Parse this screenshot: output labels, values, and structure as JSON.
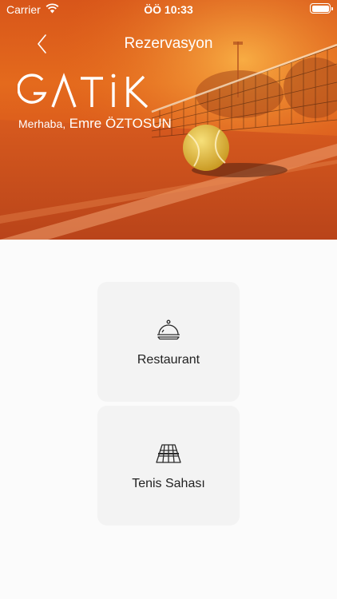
{
  "status_bar": {
    "carrier": "Carrier",
    "time": "ÖÖ 10:33",
    "icons": [
      "wifi-icon",
      "battery-icon"
    ]
  },
  "nav": {
    "title": "Rezervasyon",
    "back_icon": "chevron-left-icon"
  },
  "brand": {
    "logo_text": "GATİK"
  },
  "greeting": {
    "prefix": "Merhaba,",
    "user_name": "Emre ÖZTOSUN"
  },
  "options": [
    {
      "label": "Restaurant",
      "icon": "cloche-icon"
    },
    {
      "label": "Tenis Sahası",
      "icon": "tennis-court-icon"
    }
  ],
  "colors": {
    "hero_orange": "#e46a1d",
    "card_bg": "#f3f3f3",
    "text_dark": "#222222",
    "page_bg": "#fbfbfb"
  }
}
